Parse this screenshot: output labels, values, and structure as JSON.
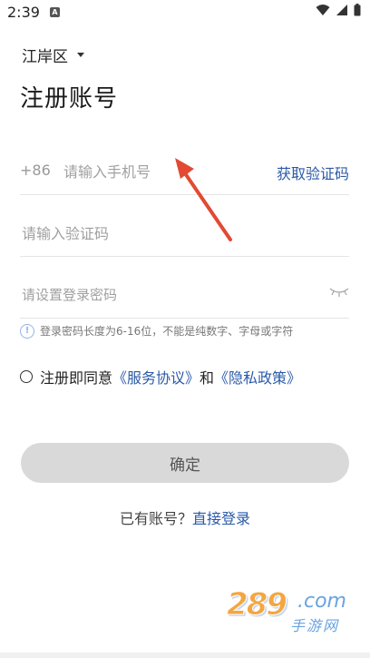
{
  "status": {
    "time": "2:39",
    "badge": "A"
  },
  "region": {
    "label": "江岸区"
  },
  "page": {
    "title": "注册账号"
  },
  "phone": {
    "country_code": "+86",
    "placeholder": "请输入手机号",
    "get_code_label": "获取验证码"
  },
  "code": {
    "placeholder": "请输入验证码"
  },
  "password": {
    "placeholder": "请设置登录密码",
    "hint": "登录密码长度为6-16位，不能是纯数字、字母或字符"
  },
  "agreement": {
    "prefix": "注册即同意",
    "service_link": "《服务协议》",
    "conjunction": "和",
    "privacy_link": "《隐私政策》"
  },
  "confirm": {
    "label": "确定"
  },
  "login": {
    "prompt": "已有账号？",
    "link": "直接登录"
  },
  "watermark": {
    "number": "289",
    "domain": ".com",
    "sub": "手游网"
  },
  "colors": {
    "link": "#2a5aa8",
    "button_bg": "#d9d9d9",
    "arrow": "#e24a33",
    "watermark_orange": "#f4a640",
    "watermark_blue": "#6aa3e0"
  }
}
